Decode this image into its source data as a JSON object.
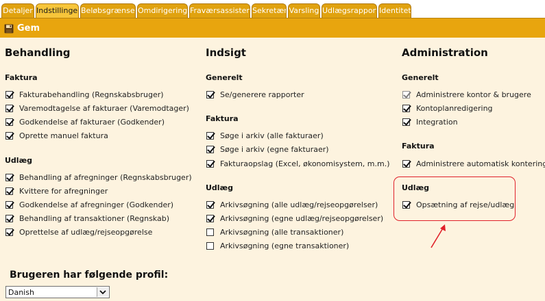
{
  "tabs": [
    {
      "label": "Detaljer",
      "active": false
    },
    {
      "label": "Indstillinger",
      "active": true
    },
    {
      "label": "Beløbsgrænser",
      "active": false
    },
    {
      "label": "Omdirigering",
      "active": false
    },
    {
      "label": "Fraværsassistent",
      "active": false
    },
    {
      "label": "Sekretær",
      "active": false
    },
    {
      "label": "Varsling",
      "active": false
    },
    {
      "label": "Udlægsrapport",
      "active": false
    },
    {
      "label": "Identitet",
      "active": false
    }
  ],
  "toolbar": {
    "save_label": "Gem"
  },
  "columns": {
    "behandling": {
      "title": "Behandling",
      "faktura": {
        "title": "Faktura",
        "items": [
          {
            "label": "Fakturabehandling (Regnskabsbruger)",
            "checked": true
          },
          {
            "label": "Varemodtagelse af fakturaer (Varemodtager)",
            "checked": true
          },
          {
            "label": "Godkendelse af fakturaer (Godkender)",
            "checked": true
          },
          {
            "label": "Oprette manuel faktura",
            "checked": true
          }
        ]
      },
      "udlaeg": {
        "title": "Udlæg",
        "items": [
          {
            "label": "Behandling af afregninger (Regnskabsbruger)",
            "checked": true
          },
          {
            "label": "Kvittere for afregninger",
            "checked": true
          },
          {
            "label": "Godkendelse af afregninger (Godkender)",
            "checked": true
          },
          {
            "label": "Behandling af transaktioner (Regnskab)",
            "checked": true
          },
          {
            "label": "Oprettelse af udlæg/rejseopgørelse",
            "checked": true
          }
        ]
      }
    },
    "indsigt": {
      "title": "Indsigt",
      "generelt": {
        "title": "Generelt",
        "items": [
          {
            "label": "Se/generere rapporter",
            "checked": true
          }
        ]
      },
      "faktura": {
        "title": "Faktura",
        "items": [
          {
            "label": "Søge i arkiv (alle fakturaer)",
            "checked": true
          },
          {
            "label": "Søge i arkiv (egne fakturaer)",
            "checked": true
          },
          {
            "label": "Fakturaopslag (Excel, økonomisystem, m.m.)",
            "checked": true
          }
        ]
      },
      "udlaeg": {
        "title": "Udlæg",
        "items": [
          {
            "label": "Arkivsøgning (alle udlæg/rejseopgørelser)",
            "checked": true
          },
          {
            "label": "Arkivsøgning (egne udlæg/rejseopgørelser)",
            "checked": true
          },
          {
            "label": "Arkivsøgning (alle transaktioner)",
            "checked": false
          },
          {
            "label": "Arkivsøgning (egne transaktioner)",
            "checked": false
          }
        ]
      }
    },
    "administration": {
      "title": "Administration",
      "generelt": {
        "title": "Generelt",
        "items": [
          {
            "label": "Administrere kontor & brugere",
            "checked": true,
            "disabled": true
          },
          {
            "label": "Kontoplanredigering",
            "checked": true
          },
          {
            "label": "Integration",
            "checked": true
          }
        ]
      },
      "faktura": {
        "title": "Faktura",
        "items": [
          {
            "label": "Administrere automatisk kontering",
            "checked": true
          }
        ]
      },
      "udlaeg": {
        "title": "Udlæg",
        "items": [
          {
            "label": "Opsætning af rejse/udlæg",
            "checked": true
          }
        ]
      }
    }
  },
  "profile": {
    "label": "Brugeren har følgende profil:",
    "selected": "Danish"
  },
  "colors": {
    "tab_bg": "#e0a20f",
    "tab_active_bg": "#f7c53a",
    "toolbar_bg": "#e8a50e",
    "content_bg": "#fdf3df",
    "highlight": "#e0202a"
  },
  "icons": {
    "save": "floppy-disk-icon",
    "dropdown": "chevron-down-icon",
    "annotation": "arrow-icon"
  }
}
